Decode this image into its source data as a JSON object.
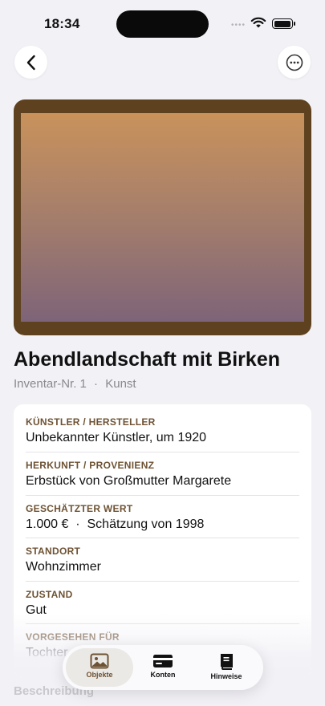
{
  "status_bar": {
    "time": "18:34"
  },
  "nav": {
    "back_icon": "chevron-left-icon",
    "more_icon": "ellipsis-circle-icon"
  },
  "artwork": {
    "frame_color": "#5e4220",
    "gradient_top": "#c9925b",
    "gradient_bottom": "#7e6478"
  },
  "item": {
    "title": "Abendlandschaft mit Birken",
    "inventory": "Inventar-Nr. 1",
    "separator": "·",
    "category": "Kunst"
  },
  "details": [
    {
      "label": "KÜNSTLER / HERSTELLER",
      "value": "Unbekannter Künstler, um 1920"
    },
    {
      "label": "HERKUNFT / PROVENIENZ",
      "value": "Erbstück von Großmutter Margarete"
    },
    {
      "label": "GESCHÄTZTER WERT",
      "value": "1.000 €  ·  Schätzung von 1998"
    },
    {
      "label": "STANDORT",
      "value": "Wohnzimmer"
    },
    {
      "label": "ZUSTAND",
      "value": "Gut"
    },
    {
      "label": "VORGESEHEN FÜR",
      "value": "Tochter"
    }
  ],
  "section": {
    "description_heading": "Beschreibung"
  },
  "tabbar": {
    "tabs": [
      {
        "label": "Objekte",
        "icon": "photo-icon",
        "selected": true
      },
      {
        "label": "Konten",
        "icon": "credit-card-icon",
        "selected": false
      },
      {
        "label": "Hinweise",
        "icon": "book-icon",
        "selected": false
      }
    ]
  },
  "colors": {
    "accent": "#6e5233",
    "background": "#f2f1f6"
  }
}
